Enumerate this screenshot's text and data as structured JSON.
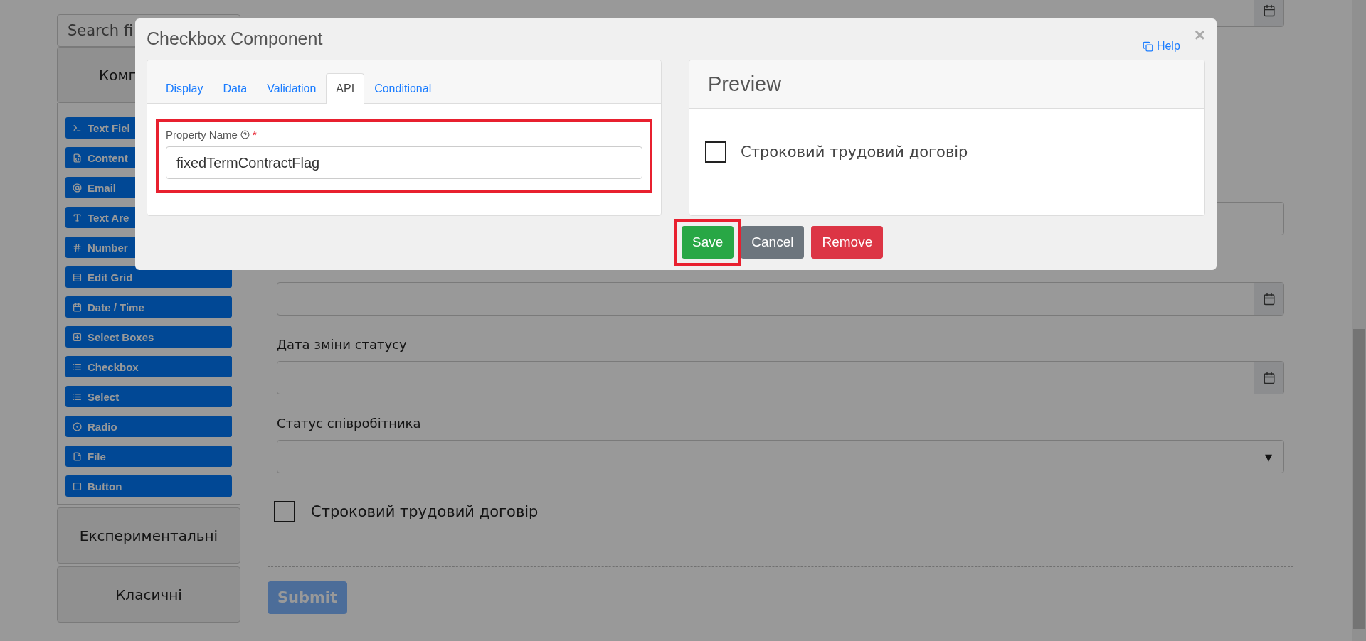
{
  "sidebar": {
    "search": {
      "placeholder": "Search fi"
    },
    "groups": [
      {
        "title": "Комп",
        "expanded": true,
        "items": [
          {
            "label": "Text Fiel"
          },
          {
            "label": "Content"
          },
          {
            "label": "Email"
          },
          {
            "label": "Text Are"
          },
          {
            "label": "Number"
          },
          {
            "label": "Edit Grid"
          },
          {
            "label": "Date / Time"
          },
          {
            "label": "Select Boxes"
          },
          {
            "label": "Checkbox"
          },
          {
            "label": "Select"
          },
          {
            "label": "Radio"
          },
          {
            "label": "File"
          },
          {
            "label": "Button"
          }
        ]
      },
      {
        "title": "Експериментальні",
        "expanded": false
      },
      {
        "title": "Класичні",
        "expanded": false
      }
    ]
  },
  "form": {
    "fields": [
      {
        "kind": "date"
      },
      {
        "kind": "text"
      },
      {
        "kind": "date"
      },
      {
        "kind": "date",
        "label": "Дата зміни статусу"
      },
      {
        "kind": "select",
        "label": "Статус співробітника",
        "caret": "▾"
      },
      {
        "kind": "checkbox",
        "label": "Строковий трудовий договір",
        "checked": false
      }
    ],
    "submit": "Submit"
  },
  "modal": {
    "title": "Checkbox Component",
    "help": "Help",
    "close": "×",
    "tabs": [
      {
        "label": "Display",
        "selected": false
      },
      {
        "label": "Data",
        "selected": false
      },
      {
        "label": "Validation",
        "selected": false
      },
      {
        "label": "API",
        "selected": true
      },
      {
        "label": "Conditional",
        "selected": false
      }
    ],
    "property": {
      "label": "Property Name",
      "required": "*",
      "value": "fixedTermContractFlag",
      "highlighted": true
    },
    "preview": {
      "title": "Preview",
      "checkbox": {
        "label": "Строковий трудовий договір",
        "checked": false
      }
    },
    "buttons": [
      {
        "kind": "success",
        "label": "Save",
        "highlighted": true
      },
      {
        "kind": "secondary",
        "label": "Cancel",
        "highlighted": false
      },
      {
        "kind": "danger",
        "label": "Remove",
        "highlighted": false
      }
    ]
  }
}
